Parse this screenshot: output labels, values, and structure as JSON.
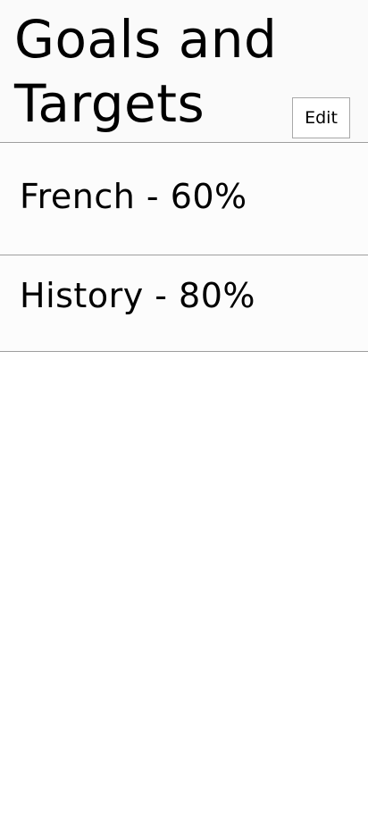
{
  "header": {
    "title": "Goals and Targets",
    "edit_label": "Edit"
  },
  "goals": [
    {
      "label": "French - 60%",
      "subject": "French",
      "target_percent": 60
    },
    {
      "label": "History - 80%",
      "subject": "History",
      "target_percent": 80
    }
  ]
}
